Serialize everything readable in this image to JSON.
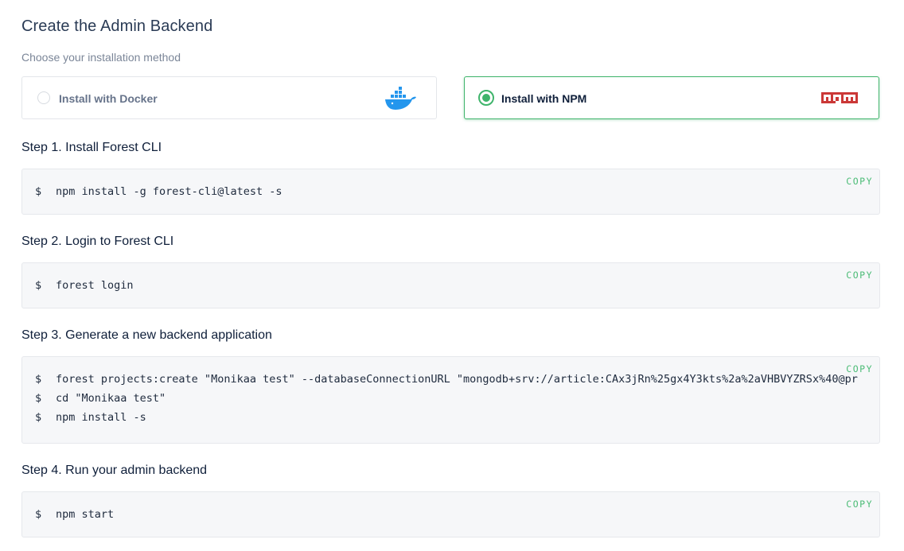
{
  "header": {
    "title": "Create the Admin Backend",
    "subtitle": "Choose your installation method"
  },
  "options": {
    "docker": {
      "label": "Install with Docker",
      "selected": false
    },
    "npm": {
      "label": "Install with NPM",
      "selected": true
    }
  },
  "copy_label": "COPY",
  "prompt": "$",
  "steps": [
    {
      "title": "Step 1. Install Forest CLI",
      "lines": [
        "npm install -g forest-cli@latest -s"
      ]
    },
    {
      "title": "Step 2. Login to Forest CLI",
      "lines": [
        "forest login"
      ]
    },
    {
      "title": "Step 3. Generate a new backend application",
      "lines": [
        "forest projects:create \"Monikaa test\" --databaseConnectionURL \"mongodb+srv://article:CAx3jRn%25gx4Y3kts%2a%2aVHBVYZRSx%40@pr",
        "cd \"Monikaa test\"",
        "npm install -s"
      ]
    },
    {
      "title": "Step 4. Run your admin backend",
      "lines": [
        "npm start"
      ]
    }
  ],
  "colors": {
    "accent": "#3fb46b",
    "copy": "#4cbc77",
    "npm_red": "#cb3837",
    "docker_blue": "#2496ed"
  }
}
